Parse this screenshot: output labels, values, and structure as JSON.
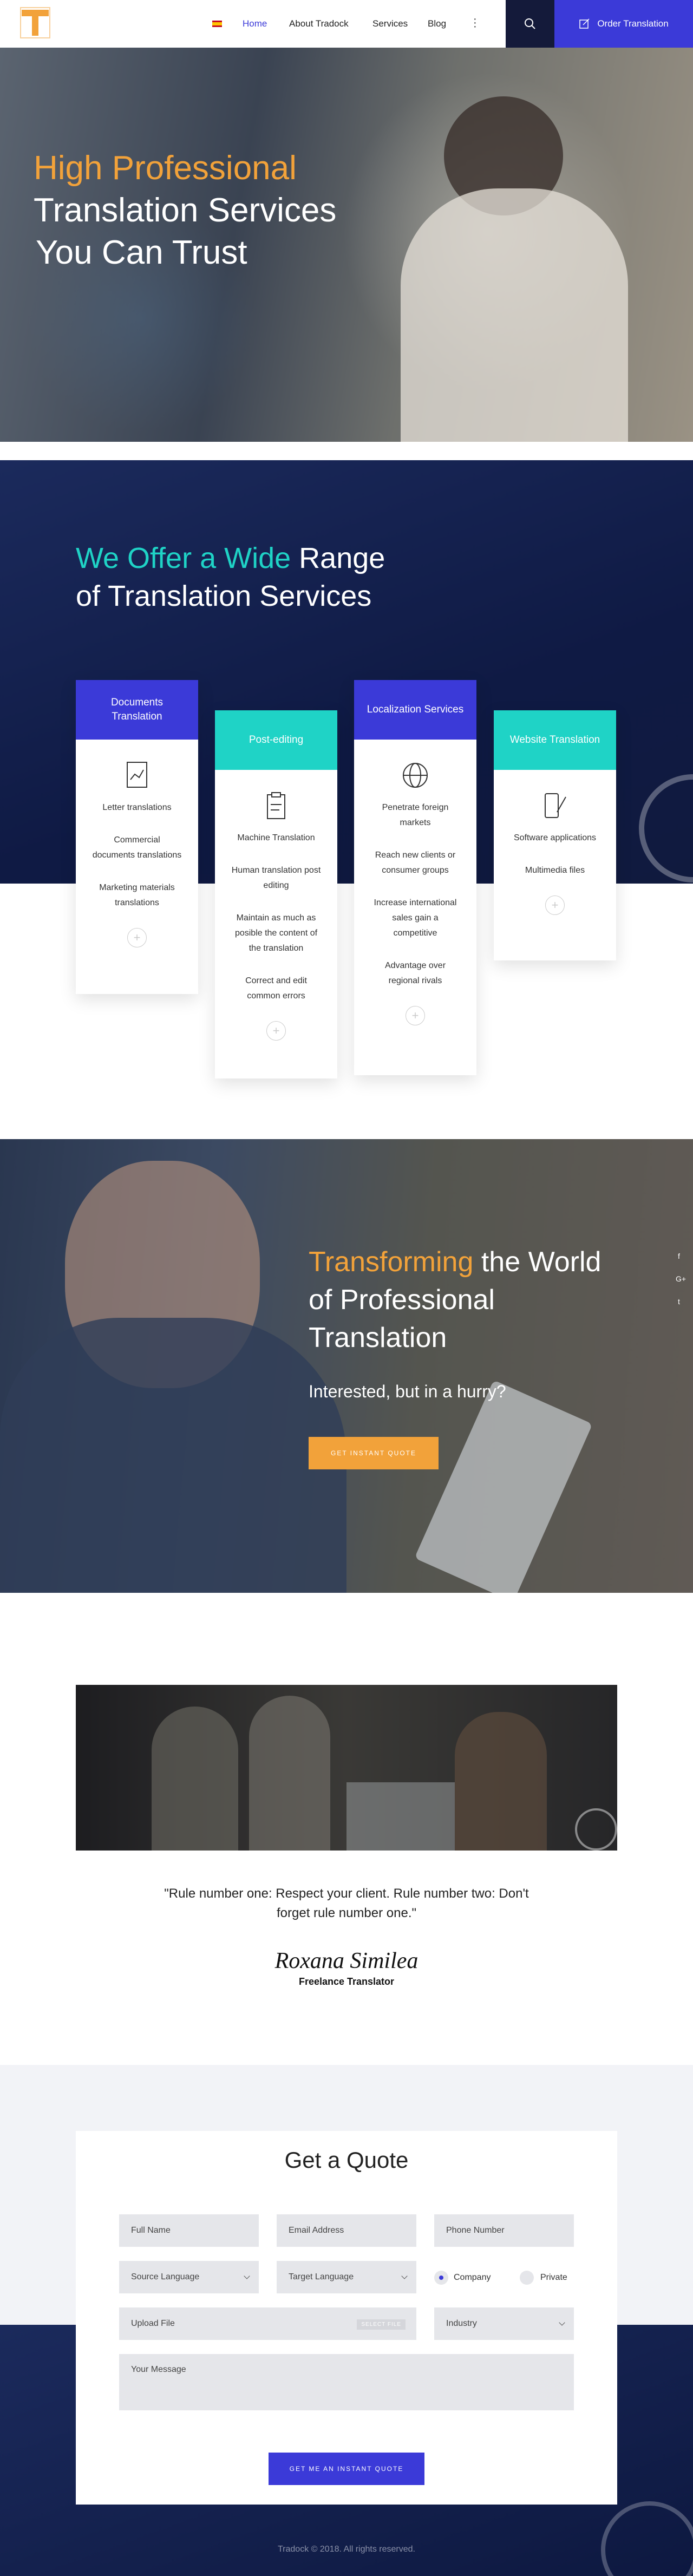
{
  "header": {
    "nav": [
      "Home",
      "About Tradock",
      "Services",
      "Blog"
    ],
    "order_label": "Order Translation"
  },
  "hero": {
    "line1": "High Professional",
    "line2": "Translation Services",
    "line3": "You Can Trust"
  },
  "services": {
    "title_accent": "We Offer a Wide",
    "title_rest": "Range",
    "title_line2": "of Translation Services",
    "cards": [
      {
        "title": "Documents Translation",
        "color": "#3b3ad8",
        "items": [
          "Letter translations",
          "Commercial documents translations",
          "Marketing materials translations"
        ]
      },
      {
        "title": "Post-editing",
        "color": "#1fd3c6",
        "items": [
          "Machine Translation",
          "Human translation post editing",
          "Maintain as much as posible the content of the translation",
          "Correct and edit common errors"
        ]
      },
      {
        "title": "Localization Services",
        "color": "#3b3ad8",
        "items": [
          "Penetrate foreign markets",
          "Reach new clients or consumer groups",
          "Increase international sales gain a competitive",
          "Advantage over regional rivals"
        ]
      },
      {
        "title": "Website Translation",
        "color": "#1fd3c6",
        "items": [
          "Software applications",
          "Multimedia files"
        ]
      }
    ]
  },
  "transform": {
    "accent": "Transforming",
    "rest1": "the World",
    "line2": "of Professional",
    "line3": "Translation",
    "sub": "Interested, but in a hurry?",
    "cta": "GET INSTANT QUOTE",
    "social": [
      "f",
      "G+",
      "t"
    ]
  },
  "testimonial": {
    "quote": "\"Rule number one: Respect your client. Rule number two: Don't forget rule number one.\"",
    "signature": "Roxana Similea",
    "role": "Freelance Translator"
  },
  "quote_form": {
    "title": "Get a Quote",
    "full_name": "Full Name",
    "email": "Email Address",
    "phone": "Phone Number",
    "source_lang": "Source Language",
    "target_lang": "Target Language",
    "company": "Company",
    "private": "Private",
    "upload": "Upload File",
    "select_file": "SELECT FILE",
    "industry": "Industry",
    "message": "Your Message",
    "submit": "GET ME AN INSTANT QUOTE"
  },
  "footer": {
    "copyright": "Tradock © 2018. All rights reserved."
  },
  "colors": {
    "accent": "#f2a23a",
    "primary": "#3b3ad8",
    "teal": "#1fd3c6",
    "navy": "#141a3a"
  }
}
